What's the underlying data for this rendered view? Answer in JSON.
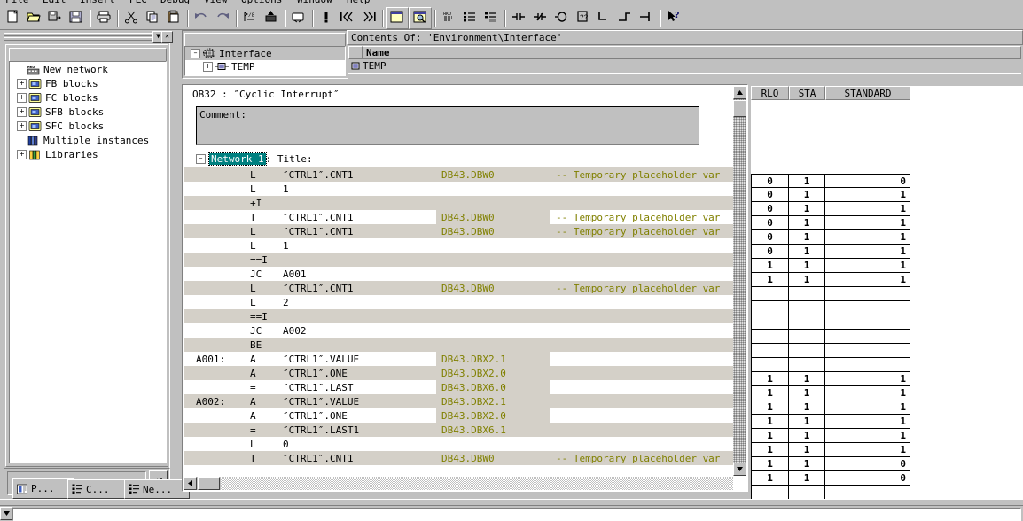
{
  "menu": {
    "items": [
      "File",
      "Edit",
      "Insert",
      "PLC",
      "Debug",
      "View",
      "Options",
      "Window",
      "Help"
    ]
  },
  "toolbar": {
    "buttons": [
      {
        "name": "new-file",
        "icon": "page",
        "sep": false
      },
      {
        "name": "open-file",
        "icon": "folder-open",
        "sep": false
      },
      {
        "name": "save-as",
        "icon": "save-as",
        "sep": false
      },
      {
        "name": "save",
        "icon": "floppy",
        "sep": true
      },
      {
        "name": "print",
        "icon": "printer",
        "sep": true
      },
      {
        "name": "cut",
        "icon": "scissors",
        "sep": false
      },
      {
        "name": "copy",
        "icon": "copy",
        "sep": false
      },
      {
        "name": "paste",
        "icon": "clipboard",
        "sep": true
      },
      {
        "name": "undo",
        "icon": "undo-arrow",
        "sep": false
      },
      {
        "name": "redo",
        "icon": "redo-arrow",
        "sep": true
      },
      {
        "name": "download",
        "icon": "plc-download",
        "sep": false
      },
      {
        "name": "upload",
        "icon": "plc-upload",
        "sep": true
      },
      {
        "name": "monitor",
        "icon": "monitor-glasses",
        "sep": true
      },
      {
        "name": "warning",
        "icon": "exclamation",
        "sep": false
      },
      {
        "name": "prev-error",
        "icon": "prev-arrows",
        "sep": false
      },
      {
        "name": "next-error",
        "icon": "next-arrows",
        "sep": true
      },
      {
        "name": "overview-on",
        "icon": "window-pane",
        "sep": false,
        "pressed": true
      },
      {
        "name": "details-on",
        "icon": "window-zoom",
        "sep": true,
        "pressed": true
      },
      {
        "name": "symbol-info",
        "icon": "symbol-list",
        "sep": false
      },
      {
        "name": "symbol-table",
        "icon": "table-list",
        "sep": false
      },
      {
        "name": "symbol-select",
        "icon": "table-select",
        "sep": true
      },
      {
        "name": "contact-no",
        "icon": "contact-no",
        "sep": false
      },
      {
        "name": "contact-nc",
        "icon": "contact-nc",
        "sep": false
      },
      {
        "name": "coil",
        "icon": "coil",
        "sep": false
      },
      {
        "name": "empty-box",
        "icon": "empty-box",
        "sep": false
      },
      {
        "name": "branch-open",
        "icon": "branch-open",
        "sep": false
      },
      {
        "name": "branch-close",
        "icon": "branch-close",
        "sep": false
      },
      {
        "name": "branch-end",
        "icon": "branch-end",
        "sep": true
      },
      {
        "name": "context-help",
        "icon": "help-pointer",
        "sep": false
      }
    ]
  },
  "tree": {
    "title_buttons": [
      "▼",
      "✕"
    ],
    "items": [
      {
        "label": "New network",
        "icon": "network-icon",
        "expand": ""
      },
      {
        "label": "FB blocks",
        "icon": "block-icon",
        "expand": "+"
      },
      {
        "label": "FC blocks",
        "icon": "block-icon",
        "expand": "+"
      },
      {
        "label": "SFB blocks",
        "icon": "block-icon",
        "expand": "+"
      },
      {
        "label": "SFC blocks",
        "icon": "block-icon",
        "expand": "+"
      },
      {
        "label": "Multiple instances",
        "icon": "instances-icon",
        "expand": ""
      },
      {
        "label": "Libraries",
        "icon": "library-icon",
        "expand": "+"
      }
    ]
  },
  "tabs": [
    {
      "label": "P...",
      "icon": "program-elements-icon",
      "active": true
    },
    {
      "label": "C...",
      "icon": "call-structure-icon",
      "active": false
    },
    {
      "label": "Ne...",
      "icon": "nesting-icon",
      "active": false
    }
  ],
  "interface": {
    "root": "Interface",
    "child": "TEMP"
  },
  "contents": {
    "header": "Contents Of: 'Environment\\Interface'",
    "columns": [
      "Name"
    ],
    "rows": [
      {
        "name": "TEMP"
      }
    ]
  },
  "editor": {
    "block_title": "OB32 :  ″Cyclic Interrupt″",
    "comment_label": "Comment:",
    "network_prefix": "Network 1",
    "network_suffix": ": Title:",
    "lines": [
      {
        "label": "",
        "op": "L",
        "arg": "″CTRL1″.CNT1",
        "addr": "DB43.DBW0",
        "comment": "-- Temporary placeholder var",
        "alt": true
      },
      {
        "label": "",
        "op": "L",
        "arg": "1",
        "addr": "",
        "comment": "",
        "alt": false
      },
      {
        "label": "",
        "op": "+I",
        "arg": "",
        "addr": "",
        "comment": "",
        "alt": true
      },
      {
        "label": "",
        "op": "T",
        "arg": "″CTRL1″.CNT1",
        "addr": "DB43.DBW0",
        "comment": "-- Temporary placeholder var",
        "alt": false
      },
      {
        "label": "",
        "op": "L",
        "arg": "″CTRL1″.CNT1",
        "addr": "DB43.DBW0",
        "comment": "-- Temporary placeholder var",
        "alt": true
      },
      {
        "label": "",
        "op": "L",
        "arg": "1",
        "addr": "",
        "comment": "",
        "alt": false
      },
      {
        "label": "",
        "op": "==I",
        "arg": "",
        "addr": "",
        "comment": "",
        "alt": true
      },
      {
        "label": "",
        "op": "JC",
        "arg": "A001",
        "addr": "",
        "comment": "",
        "alt": false
      },
      {
        "label": "",
        "op": "L",
        "arg": "″CTRL1″.CNT1",
        "addr": "DB43.DBW0",
        "comment": "-- Temporary placeholder var",
        "alt": true
      },
      {
        "label": "",
        "op": "L",
        "arg": "2",
        "addr": "",
        "comment": "",
        "alt": false
      },
      {
        "label": "",
        "op": "==I",
        "arg": "",
        "addr": "",
        "comment": "",
        "alt": true
      },
      {
        "label": "",
        "op": "JC",
        "arg": "A002",
        "addr": "",
        "comment": "",
        "alt": false
      },
      {
        "label": "",
        "op": "BE",
        "arg": "",
        "addr": "",
        "comment": "",
        "alt": true
      },
      {
        "label": "A001:",
        "op": "A",
        "arg": "″CTRL1″.VALUE",
        "addr": "DB43.DBX2.1",
        "comment": "",
        "alt": false
      },
      {
        "label": "",
        "op": "A",
        "arg": "″CTRL1″.ONE",
        "addr": "DB43.DBX2.0",
        "comment": "",
        "alt": true
      },
      {
        "label": "",
        "op": "=",
        "arg": "″CTRL1″.LAST",
        "addr": "DB43.DBX6.0",
        "comment": "",
        "alt": false
      },
      {
        "label": "A002:",
        "op": "A",
        "arg": "″CTRL1″.VALUE",
        "addr": "DB43.DBX2.1",
        "comment": "",
        "alt": true
      },
      {
        "label": "",
        "op": "A",
        "arg": "″CTRL1″.ONE",
        "addr": "DB43.DBX2.0",
        "comment": "",
        "alt": false
      },
      {
        "label": "",
        "op": "=",
        "arg": "″CTRL1″.LAST1",
        "addr": "DB43.DBX6.1",
        "comment": "",
        "alt": true
      },
      {
        "label": "",
        "op": "L",
        "arg": "0",
        "addr": "",
        "comment": "",
        "alt": false
      },
      {
        "label": "",
        "op": "T",
        "arg": "″CTRL1″.CNT1",
        "addr": "DB43.DBW0",
        "comment": "-- Temporary placeholder var",
        "alt": true
      }
    ]
  },
  "status_table": {
    "columns": [
      "RLO",
      "STA",
      "STANDARD"
    ],
    "rows": [
      {
        "rlo": "0",
        "sta": "1",
        "standard": "0"
      },
      {
        "rlo": "0",
        "sta": "1",
        "standard": "1"
      },
      {
        "rlo": "0",
        "sta": "1",
        "standard": "1"
      },
      {
        "rlo": "0",
        "sta": "1",
        "standard": "1"
      },
      {
        "rlo": "0",
        "sta": "1",
        "standard": "1"
      },
      {
        "rlo": "0",
        "sta": "1",
        "standard": "1"
      },
      {
        "rlo": "1",
        "sta": "1",
        "standard": "1"
      },
      {
        "rlo": "1",
        "sta": "1",
        "standard": "1"
      },
      {
        "rlo": "",
        "sta": "",
        "standard": ""
      },
      {
        "rlo": "",
        "sta": "",
        "standard": ""
      },
      {
        "rlo": "",
        "sta": "",
        "standard": ""
      },
      {
        "rlo": "",
        "sta": "",
        "standard": ""
      },
      {
        "rlo": "",
        "sta": "",
        "standard": ""
      },
      {
        "rlo": "",
        "sta": "",
        "standard": ""
      },
      {
        "rlo": "1",
        "sta": "1",
        "standard": "1"
      },
      {
        "rlo": "1",
        "sta": "1",
        "standard": "1"
      },
      {
        "rlo": "1",
        "sta": "1",
        "standard": "1"
      },
      {
        "rlo": "1",
        "sta": "1",
        "standard": "1"
      },
      {
        "rlo": "1",
        "sta": "1",
        "standard": "1"
      },
      {
        "rlo": "1",
        "sta": "1",
        "standard": "1"
      },
      {
        "rlo": "1",
        "sta": "1",
        "standard": "0"
      },
      {
        "rlo": "1",
        "sta": "1",
        "standard": "0"
      },
      {
        "rlo": "",
        "sta": "",
        "standard": ""
      }
    ]
  },
  "colors": {
    "face": "#c0c0c0",
    "alt_row": "#d4d0c8",
    "address": "#808000",
    "comment": "#808000",
    "selection": "#008080"
  }
}
